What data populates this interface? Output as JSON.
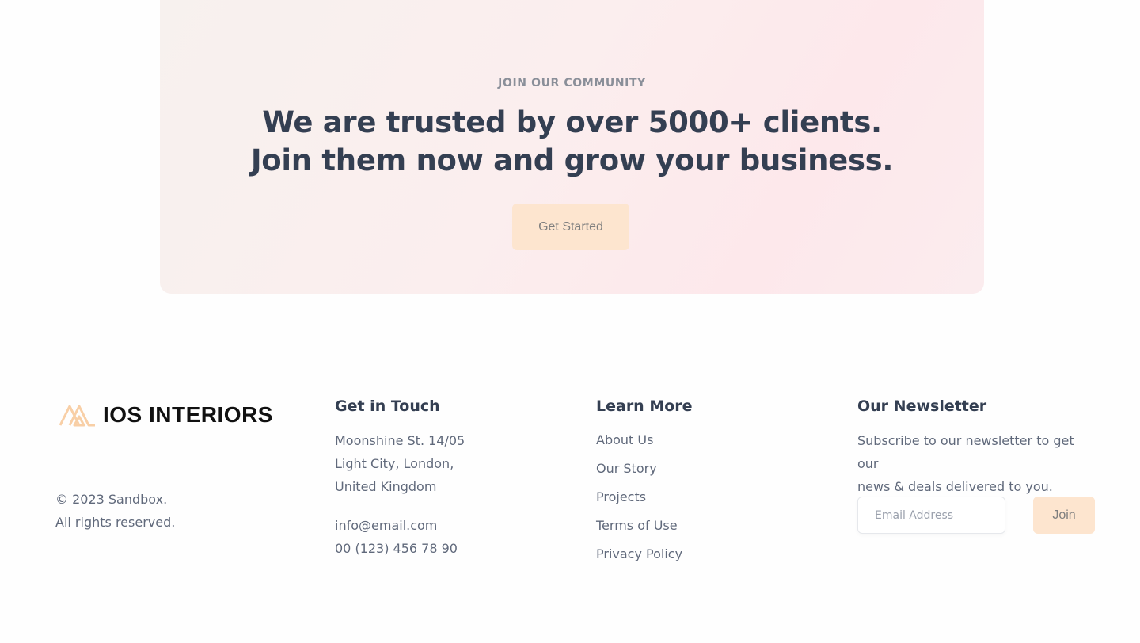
{
  "cta": {
    "eyebrow": "JOIN OUR COMMUNITY",
    "title_line1": "We are trusted by over 5000+ clients.",
    "title_line2": "Join them now and grow your business.",
    "button_label": "Get Started"
  },
  "footer": {
    "brand": {
      "name": "IOS INTERIORS",
      "logo_color": "#f8cfa6",
      "copyright_line1": "© 2023 Sandbox.",
      "copyright_line2": "All rights reserved."
    },
    "contact": {
      "title": "Get in Touch",
      "address_line1": "Moonshine St. 14/05",
      "address_line2": "Light City, London,",
      "address_line3": "United Kingdom",
      "email": "info@email.com",
      "phone": "00 (123) 456 78 90"
    },
    "learn_more": {
      "title": "Learn More",
      "links": [
        "About Us",
        "Our Story",
        "Projects",
        "Terms of Use",
        "Privacy Policy"
      ]
    },
    "newsletter": {
      "title": "Our Newsletter",
      "description_line1": "Subscribe to our newsletter to get our",
      "description_line2": "news & deals delivered to you.",
      "email_placeholder": "Email Address",
      "join_label": "Join"
    }
  },
  "colors": {
    "accent": "#fde5cf",
    "heading": "#343f52",
    "body_text": "#60697b"
  }
}
